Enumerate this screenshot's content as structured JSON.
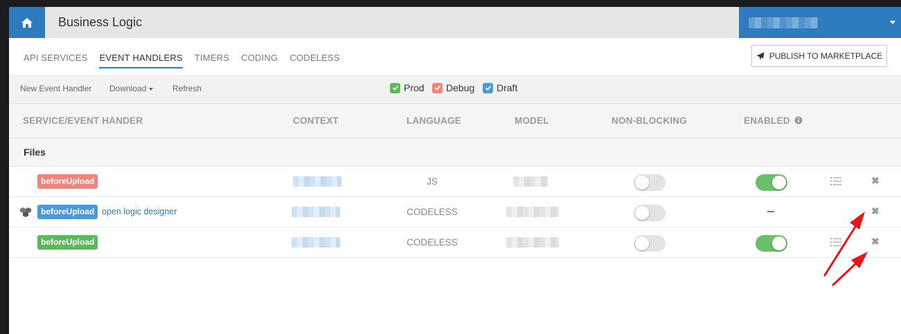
{
  "header": {
    "title": "Business Logic",
    "icons": {
      "home": "home-icon",
      "user_menu": "chevron-down-icon"
    }
  },
  "tabs": [
    {
      "label": "API SERVICES",
      "active": false
    },
    {
      "label": "EVENT HANDLERS",
      "active": true
    },
    {
      "label": "TIMERS",
      "active": false
    },
    {
      "label": "CODING",
      "active": false
    },
    {
      "label": "CODELESS",
      "active": false
    }
  ],
  "publish": {
    "label": "PUBLISH TO MARKETPLACE",
    "icon": "paper-plane-icon"
  },
  "toolbar": {
    "new_handler": "New Event Handler",
    "download": "Download",
    "refresh": "Refresh",
    "filters": [
      {
        "label": "Prod",
        "color": "#5cb85c",
        "checked": true
      },
      {
        "label": "Debug",
        "color": "#f0847a",
        "checked": true
      },
      {
        "label": "Draft",
        "color": "#4a9bd4",
        "checked": true
      }
    ]
  },
  "table": {
    "columns": [
      "SERVICE/EVENT HANDER",
      "CONTEXT",
      "LANGUAGE",
      "MODEL",
      "NON-BLOCKING",
      "ENABLED"
    ],
    "enabled_info_icon": "info-circle-icon",
    "group": "Files",
    "rows": [
      {
        "handler": "beforeUpload",
        "badge_color": "#f0847a",
        "link": "",
        "language": "JS",
        "non_blocking": false,
        "enabled": true,
        "enabled_shown": true,
        "has_log": true
      },
      {
        "handler": "beforeUpload",
        "badge_color": "#4a9bd4",
        "link": "open logic designer",
        "language": "CODELESS",
        "non_blocking": false,
        "enabled": false,
        "enabled_shown": false,
        "has_log": false
      },
      {
        "handler": "beforeUpload",
        "badge_color": "#5cb85c",
        "link": "",
        "language": "CODELESS",
        "non_blocking": false,
        "enabled": true,
        "enabled_shown": true,
        "has_log": true
      }
    ]
  },
  "annotation": {
    "arrow_color": "#e8141a"
  }
}
